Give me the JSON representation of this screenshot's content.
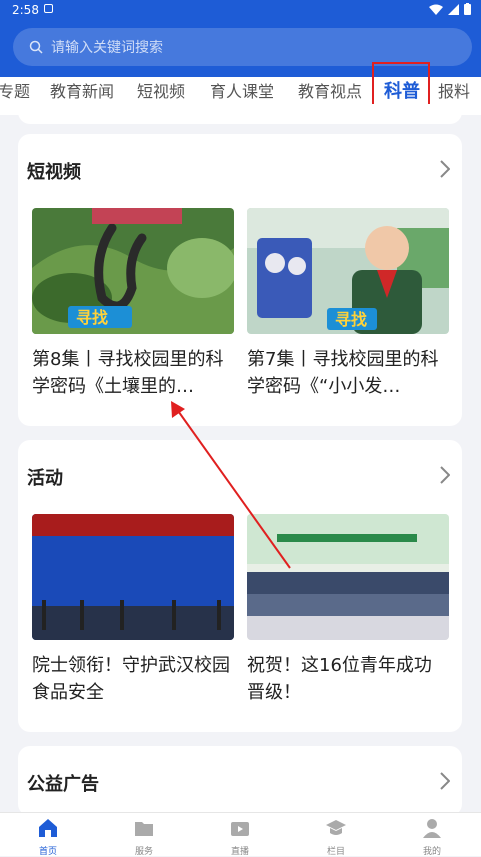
{
  "status_bar": {
    "time": "2:58"
  },
  "search": {
    "placeholder": "请输入关键词搜索"
  },
  "tabs": [
    {
      "label": "专题"
    },
    {
      "label": "教育新闻"
    },
    {
      "label": "短视频"
    },
    {
      "label": "育人课堂"
    },
    {
      "label": "教育视点"
    },
    {
      "label": "科普",
      "active": true
    },
    {
      "label": "报料"
    }
  ],
  "short_video": {
    "title": "短视频",
    "items": [
      {
        "caption": "第8集丨寻找校园里的科学密码《土壤里的…",
        "thumb_text": "寻找"
      },
      {
        "caption": "第7集丨寻找校园里的科学密码《“小小发…",
        "thumb_text": "寻找"
      }
    ]
  },
  "activities": {
    "title": "活动",
    "items": [
      {
        "caption": "院士领衔！守护武汉校园食品安全"
      },
      {
        "caption": "祝贺！这16位青年成功晋级！"
      }
    ]
  },
  "public_ads": {
    "title": "公益广告"
  },
  "bottom_nav": [
    {
      "label": "首页",
      "icon": "home-icon",
      "active": true
    },
    {
      "label": "服务",
      "icon": "folder-icon"
    },
    {
      "label": "直播",
      "icon": "tv-icon"
    },
    {
      "label": "栏目",
      "icon": "graduation-cap-icon"
    },
    {
      "label": "我的",
      "icon": "user-icon"
    }
  ],
  "colors": {
    "brand": "#1e5cd6",
    "highlight": "#e02020",
    "background": "#f2f3f7"
  }
}
